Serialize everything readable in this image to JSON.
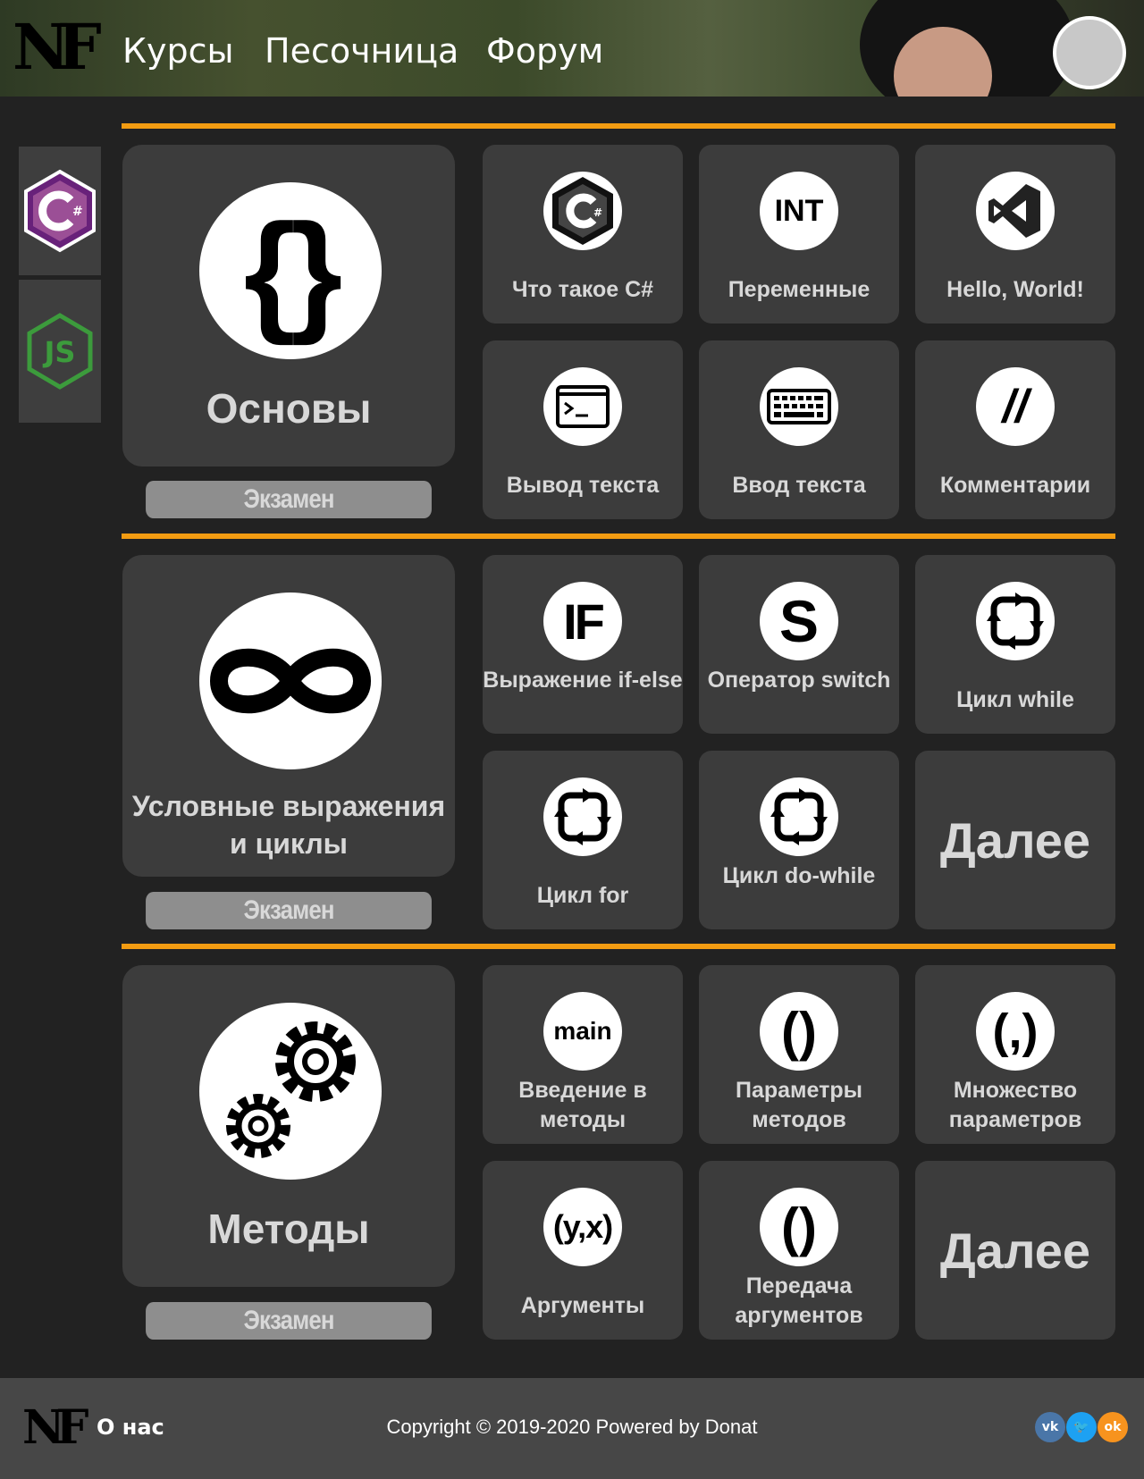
{
  "header": {
    "logo": "NF",
    "nav": [
      "Курсы",
      "Песочница",
      "Форум"
    ]
  },
  "sidebar": [
    {
      "icon": "csharp-hexagon-icon",
      "active": true
    },
    {
      "icon": "nodejs-icon",
      "active": false
    }
  ],
  "colors": {
    "accent": "#f39c12",
    "tile": "#3c3c3c",
    "background": "#222222",
    "exam": "#8e8e8e",
    "csharp": "#953dac",
    "nodejs": "#3c9b3c"
  },
  "sections": [
    {
      "main": {
        "title": "Основы",
        "icon": "curly-braces-icon"
      },
      "exam": "Экзамен",
      "lessons": [
        {
          "label": "Что такое C#",
          "icon": "csharp-logo-icon"
        },
        {
          "label": "Переменные",
          "icon": "int-icon",
          "glyph": "INT"
        },
        {
          "label": "Hello, World!",
          "icon": "visual-studio-icon"
        },
        {
          "label": "Вывод текста",
          "icon": "terminal-icon"
        },
        {
          "label": "Ввод текста",
          "icon": "keyboard-icon"
        },
        {
          "label": "Комментарии",
          "icon": "comment-slashes-icon",
          "glyph": "//"
        }
      ]
    },
    {
      "main": {
        "title": "Условные выражения и циклы",
        "icon": "infinity-icon"
      },
      "exam": "Экзамен",
      "lessons": [
        {
          "label": "Выражение if-else",
          "icon": "if-icon",
          "glyph": "IF"
        },
        {
          "label": "Оператор switch",
          "icon": "switch-icon",
          "glyph": "S"
        },
        {
          "label": "Цикл while",
          "icon": "loop-arrows-icon"
        },
        {
          "label": "Цикл for",
          "icon": "loop-arrows-icon"
        },
        {
          "label": "Цикл do-while",
          "icon": "loop-arrows-icon"
        },
        {
          "label": "Далее",
          "more": true
        }
      ]
    },
    {
      "main": {
        "title": "Методы",
        "icon": "gears-icon"
      },
      "exam": "Экзамен",
      "lessons": [
        {
          "label": "Введение в методы",
          "icon": "main-icon",
          "glyph": "main"
        },
        {
          "label": "Параметры методов",
          "icon": "parentheses-icon",
          "glyph": "()"
        },
        {
          "label": "Множество параметров",
          "icon": "params-comma-icon",
          "glyph": "(,)"
        },
        {
          "label": "Аргументы",
          "icon": "args-yx-icon",
          "glyph": "(y,x)"
        },
        {
          "label": "Передача аргументов",
          "icon": "parentheses-icon",
          "glyph": "()"
        },
        {
          "label": "Далее",
          "more": true
        }
      ]
    }
  ],
  "footer": {
    "logo": "NF",
    "about": "О нас",
    "copyright": "Copyright © 2019-2020 Powered by Donat",
    "social": [
      {
        "icon": "vk-icon",
        "glyph": "vk",
        "color": "#4a76a8"
      },
      {
        "icon": "twitter-icon",
        "glyph": "🐦",
        "color": "#1da1f2"
      },
      {
        "icon": "odnoklassniki-icon",
        "glyph": "ok",
        "color": "#f7931e"
      }
    ]
  }
}
